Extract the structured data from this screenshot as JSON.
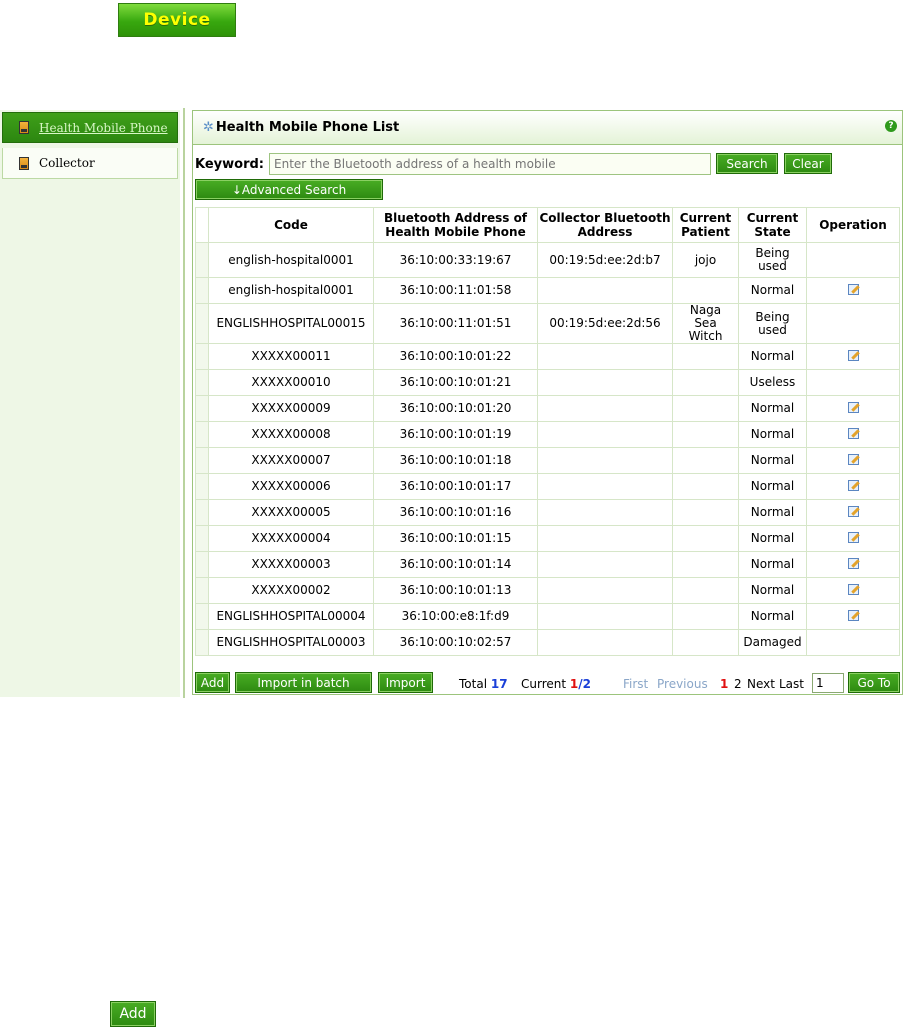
{
  "top_tab": {
    "label": "Device"
  },
  "sidebar": {
    "items": [
      {
        "label": "Health Mobile Phone",
        "active": true
      },
      {
        "label": "Collector",
        "active": false
      }
    ]
  },
  "panel": {
    "title": "Health Mobile Phone List",
    "keyword_label": "Keyword:",
    "search_placeholder": "Enter the Bluetooth address of a health mobile",
    "search_button": "Search",
    "clear_button": "Clear",
    "advanced_search": "↓Advanced Search"
  },
  "table": {
    "headers": [
      "Code",
      "Bluetooth Address of Health Mobile Phone",
      "Collector Bluetooth Address",
      "Current Patient",
      "Current State",
      "Operation"
    ],
    "rows": [
      {
        "code": "english-hospital0001",
        "bt": "36:10:00:33:19:67",
        "collector": "00:19:5d:ee:2d:b7",
        "patient": "jojo",
        "state": "Being used",
        "edit": false
      },
      {
        "code": "english-hospital0001",
        "bt": "36:10:00:11:01:58",
        "collector": "",
        "patient": "",
        "state": "Normal",
        "edit": true
      },
      {
        "code": "ENGLISHHOSPITAL00015",
        "bt": "36:10:00:11:01:51",
        "collector": "00:19:5d:ee:2d:56",
        "patient": "Naga Sea Witch",
        "state": "Being used",
        "edit": false
      },
      {
        "code": "XXXXX00011",
        "bt": "36:10:00:10:01:22",
        "collector": "",
        "patient": "",
        "state": "Normal",
        "edit": true
      },
      {
        "code": "XXXXX00010",
        "bt": "36:10:00:10:01:21",
        "collector": "",
        "patient": "",
        "state": "Useless",
        "edit": false
      },
      {
        "code": "XXXXX00009",
        "bt": "36:10:00:10:01:20",
        "collector": "",
        "patient": "",
        "state": "Normal",
        "edit": true
      },
      {
        "code": "XXXXX00008",
        "bt": "36:10:00:10:01:19",
        "collector": "",
        "patient": "",
        "state": "Normal",
        "edit": true
      },
      {
        "code": "XXXXX00007",
        "bt": "36:10:00:10:01:18",
        "collector": "",
        "patient": "",
        "state": "Normal",
        "edit": true
      },
      {
        "code": "XXXXX00006",
        "bt": "36:10:00:10:01:17",
        "collector": "",
        "patient": "",
        "state": "Normal",
        "edit": true
      },
      {
        "code": "XXXXX00005",
        "bt": "36:10:00:10:01:16",
        "collector": "",
        "patient": "",
        "state": "Normal",
        "edit": true
      },
      {
        "code": "XXXXX00004",
        "bt": "36:10:00:10:01:15",
        "collector": "",
        "patient": "",
        "state": "Normal",
        "edit": true
      },
      {
        "code": "XXXXX00003",
        "bt": "36:10:00:10:01:14",
        "collector": "",
        "patient": "",
        "state": "Normal",
        "edit": true
      },
      {
        "code": "XXXXX00002",
        "bt": "36:10:00:10:01:13",
        "collector": "",
        "patient": "",
        "state": "Normal",
        "edit": true
      },
      {
        "code": "ENGLISHHOSPITAL00004",
        "bt": "36:10:00:e8:1f:d9",
        "collector": "",
        "patient": "",
        "state": "Normal",
        "edit": true
      },
      {
        "code": "ENGLISHHOSPITAL00003",
        "bt": "36:10:00:10:02:57",
        "collector": "",
        "patient": "",
        "state": "Damaged",
        "edit": false
      }
    ]
  },
  "footer": {
    "add": "Add",
    "import_batch": "Import in batch",
    "import": "Import",
    "total_label": "Total",
    "total": "17",
    "current_label": "Current",
    "current_page": "1",
    "page_sep": "/",
    "page_count": "2",
    "first": "First",
    "previous": "Previous",
    "page1": "1",
    "page2": "2",
    "next": "Next",
    "last": "Last",
    "page_input": "1",
    "goto": "Go To"
  },
  "bottom": {
    "add": "Add"
  },
  "icons": {
    "sidebar_item": "phone-icon",
    "header": "gear-icon",
    "help": "help-icon",
    "edit": "edit-icon"
  },
  "colors": {
    "accent": "#38a80f",
    "tab_text": "#ffff00",
    "panel_border": "#9cc47c",
    "total_value": "#1a3fd8",
    "current_page": "#e01010"
  }
}
